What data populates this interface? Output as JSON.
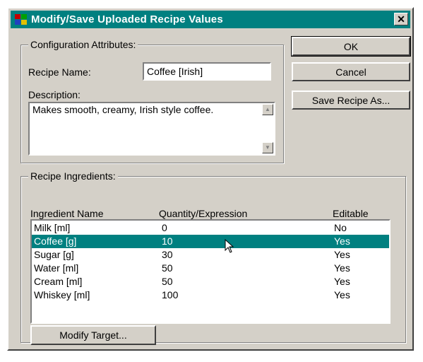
{
  "window": {
    "title": "Modify/Save Uploaded Recipe Values",
    "close_glyph": "✕"
  },
  "config": {
    "group_label": "Configuration Attributes:",
    "recipe_name_label": "Recipe Name:",
    "recipe_name_value": "Coffee [Irish]",
    "description_label": "Description:",
    "description_value": "Makes smooth, creamy, Irish style coffee."
  },
  "buttons": {
    "ok": "OK",
    "cancel": "Cancel",
    "save_as": "Save Recipe As...",
    "modify_target": "Modify Target..."
  },
  "ingredients": {
    "group_label": "Recipe Ingredients:",
    "columns": [
      "Ingredient Name",
      "Quantity/Expression",
      "Editable"
    ],
    "rows": [
      {
        "name": "Milk [ml]",
        "qty": "0",
        "editable": "No",
        "selected": false
      },
      {
        "name": "Coffee [g]",
        "qty": "10",
        "editable": "Yes",
        "selected": true
      },
      {
        "name": "Sugar [g]",
        "qty": "30",
        "editable": "Yes",
        "selected": false
      },
      {
        "name": "Water [ml]",
        "qty": "50",
        "editable": "Yes",
        "selected": false
      },
      {
        "name": "Cream [ml]",
        "qty": "50",
        "editable": "Yes",
        "selected": false
      },
      {
        "name": "Whiskey [ml]",
        "qty": "100",
        "editable": "Yes",
        "selected": false
      }
    ]
  },
  "colors": {
    "titlebar": "#008080",
    "selection": "#008080",
    "face": "#d4d0c8"
  },
  "icons": [
    "app-icon",
    "close-icon",
    "scroll-up-icon",
    "scroll-down-icon",
    "mouse-cursor-icon"
  ]
}
